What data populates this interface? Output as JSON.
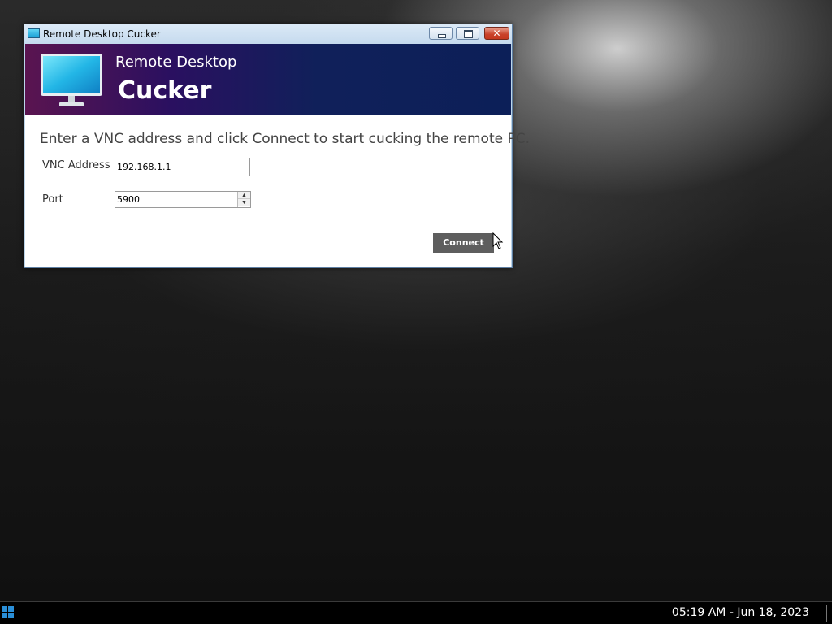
{
  "window": {
    "title": "Remote Desktop Cucker",
    "controls": {
      "minimize": "minimize",
      "maximize": "maximize",
      "close": "✕"
    }
  },
  "banner": {
    "title": "Remote Desktop",
    "subtitle": "Cucker",
    "icon": "monitor-icon"
  },
  "form": {
    "instructions": "Enter a VNC address and click Connect to start cucking the remote PC.",
    "vnc_address_label": "VNC Address",
    "vnc_address_value": "192.168.1.1",
    "port_label": "Port",
    "port_value": "5900",
    "connect_label": "Connect"
  },
  "taskbar": {
    "clock": "05:19 AM - Jun 18, 2023"
  },
  "colors": {
    "banner_start": "#5a1450",
    "banner_end": "#0c1f58",
    "button": "#5e5e5e",
    "start_icon": "#2a8fd8"
  }
}
